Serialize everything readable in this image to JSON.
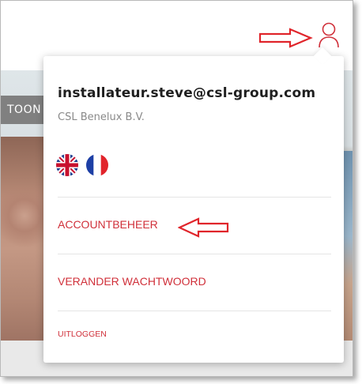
{
  "header": {
    "user_icon": "user-icon"
  },
  "background": {
    "tab_label": "TOON"
  },
  "account_menu": {
    "email": "installateur.steve@csl-group.com",
    "company": "CSL Benelux B.V.",
    "languages": [
      {
        "name": "uk-flag-icon"
      },
      {
        "name": "france-flag-icon"
      }
    ],
    "items": {
      "account": "ACCOUNTBEHEER",
      "password": "VERANDER WACHTWOORD",
      "logout": "UITLOGGEN"
    }
  },
  "colors": {
    "link_red": "#d0303a",
    "annotation_red": "#e0252b"
  }
}
